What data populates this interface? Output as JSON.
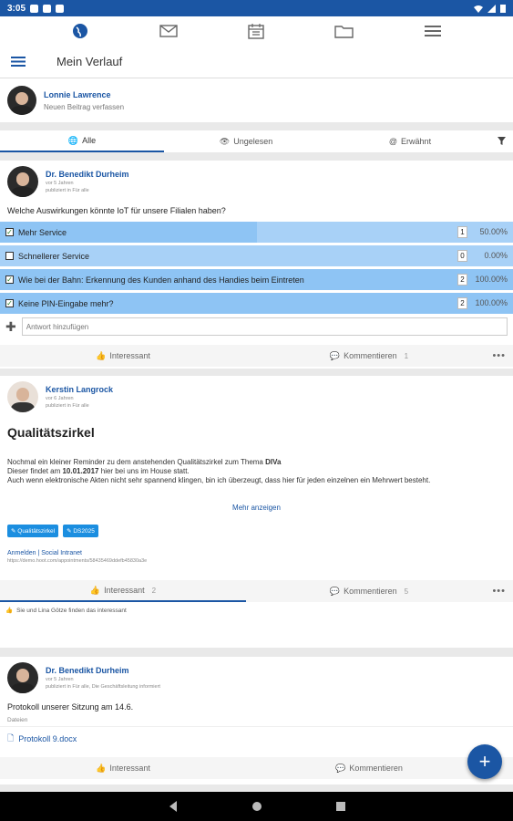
{
  "status": {
    "time": "3:05"
  },
  "header": {
    "title": "Mein Verlauf"
  },
  "composer": {
    "name": "Lonnie Lawrence",
    "prompt": "Neuen Beitrag verfassen"
  },
  "filters": {
    "all": "Alle",
    "unread": "Ungelesen",
    "mentioned": "Erwähnt"
  },
  "poll": {
    "author": "Dr. Benedikt Durheim",
    "time": "vor 5 Jahren",
    "published": "publiziert in Für alle",
    "question": "Welche Auswirkungen könnte IoT für unsere Filialen haben?",
    "options": [
      {
        "label": "Mehr Service",
        "count": "1",
        "pct": "50.00%",
        "checked": true,
        "fill": 0.5
      },
      {
        "label": "Schnellerer Service",
        "count": "0",
        "pct": "0.00%",
        "checked": false,
        "fill": 0
      },
      {
        "label": "Wie bei der Bahn: Erkennung des Kunden anhand des Handies beim Eintreten",
        "count": "2",
        "pct": "100.00%",
        "checked": true,
        "fill": 1
      },
      {
        "label": "Keine PIN-Eingabe mehr?",
        "count": "2",
        "pct": "100.00%",
        "checked": true,
        "fill": 1
      }
    ],
    "answer_placeholder": "Antwort hinzufügen",
    "like": "Interessant",
    "comment": "Kommentieren",
    "comment_count": "1"
  },
  "post2": {
    "author": "Kerstin Langrock",
    "time": "vor 6 Jahren",
    "published": "publiziert in Für alle",
    "title": "Qualitätszirkel",
    "line1_a": "Nochmal ein kleiner Reminder zu dem anstehenden Qualitätszirkel zum Thema ",
    "line1_b": "DIVa",
    "line2_a": "Dieser findet am ",
    "line2_b": "10.01.2017",
    "line2_c": " hier bei uns im House statt.",
    "line3": "Auch wenn elektronische Akten nicht sehr spannend klingen, bin ich überzeugt, dass hier für jeden einzelnen ein Mehrwert besteht.",
    "show_more": "Mehr anzeigen",
    "tags": [
      "Qualitätszirkel",
      "DS2025"
    ],
    "link": "Anmelden | Social Intranet",
    "url": "https://demo.hoot.com/appointments/58435469ddefb45830a3e",
    "like": "Interessant",
    "like_count": "2",
    "comment": "Kommentieren",
    "comment_count": "5",
    "likers": "Sie und Lina Götze finden das interessant"
  },
  "post3": {
    "author": "Dr. Benedikt Durheim",
    "time": "vor 5 Jahren",
    "published": "publiziert in Für alle, Die Geschäftsleitung informiert",
    "text": "Protokoll unserer Sitzung am 14.6.",
    "files_label": "Dateien",
    "file": "Protokoll 9.docx",
    "like": "Interessant",
    "comment": "Kommentieren"
  },
  "colors": {
    "brand": "#1b56a4",
    "poll_bg": "#a8d1f7"
  }
}
